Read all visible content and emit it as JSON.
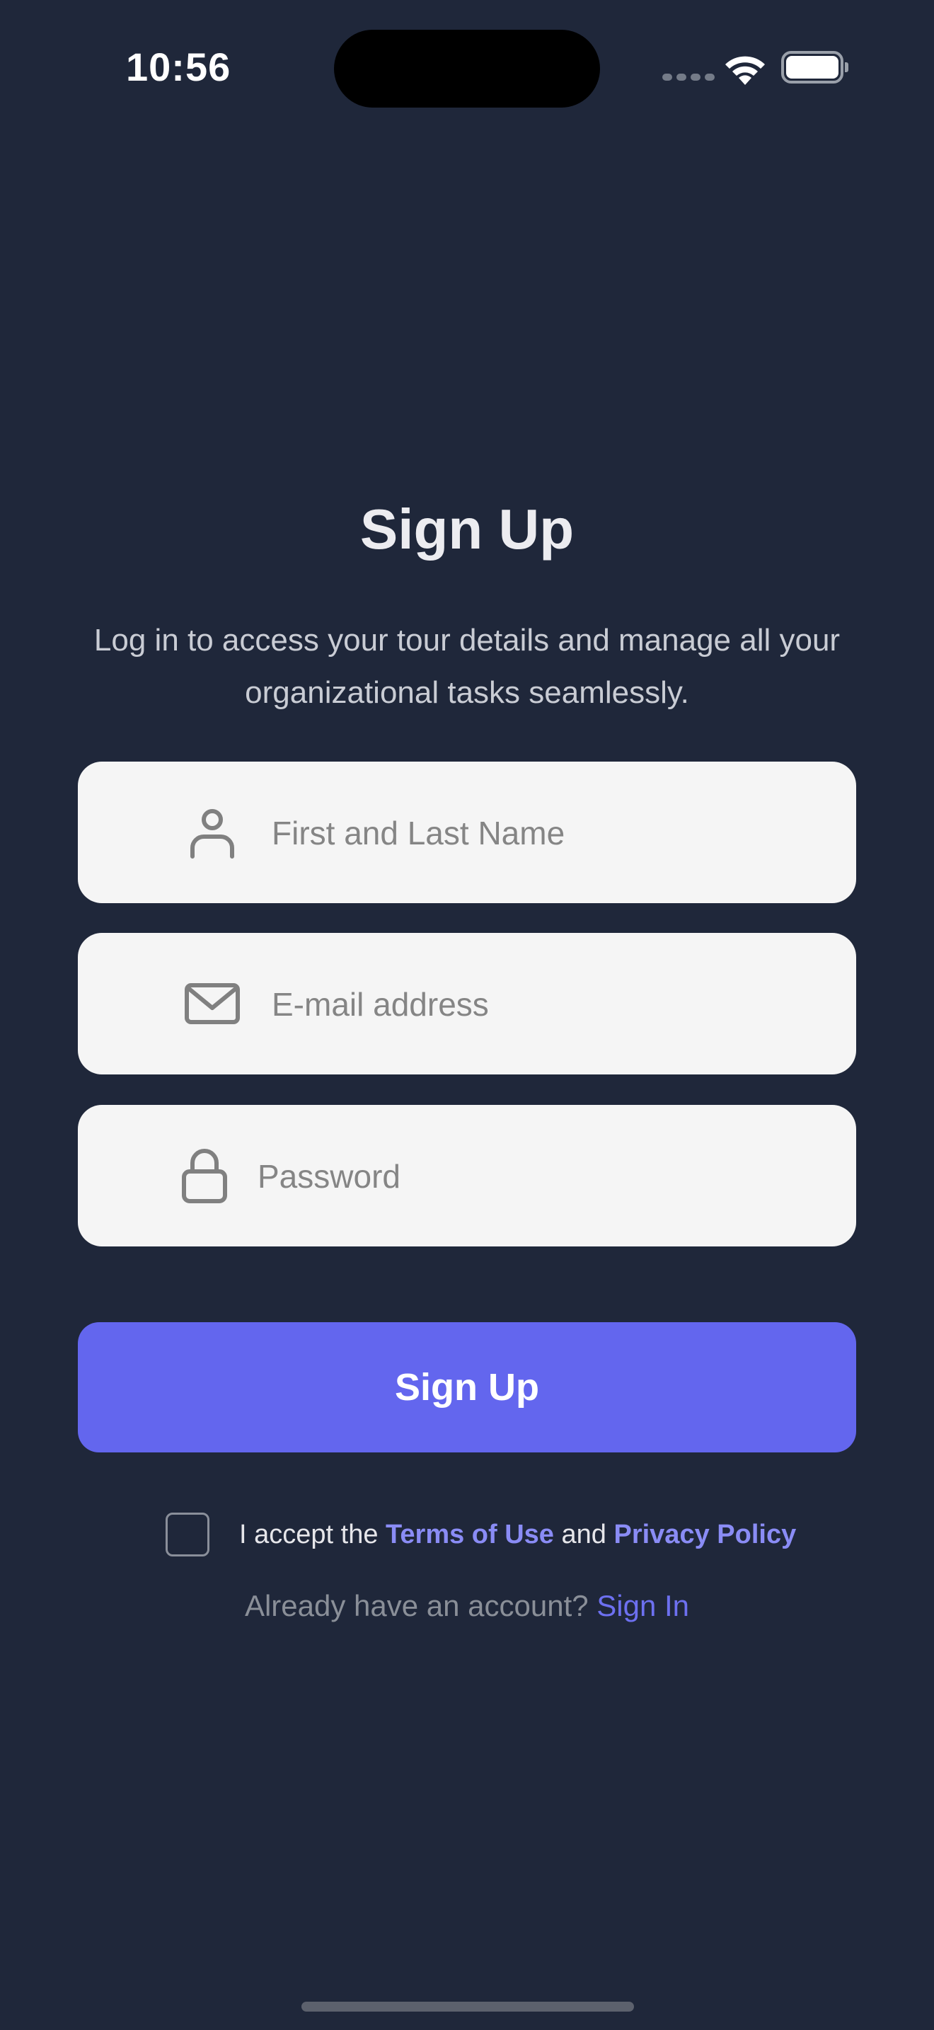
{
  "status_bar": {
    "time": "10:56"
  },
  "signup": {
    "title": "Sign Up",
    "subtitle_line1": "Log in to access your tour details and manage all your",
    "subtitle_line2": "organizational tasks seamlessly.",
    "fields": {
      "name": {
        "placeholder": "First and Last Name",
        "value": "",
        "icon": "person-icon"
      },
      "email": {
        "placeholder": "E-mail address",
        "value": "",
        "icon": "envelope-icon"
      },
      "password": {
        "placeholder": "Password",
        "value": "",
        "icon": "lock-icon"
      }
    },
    "submit_label": "Sign Up",
    "terms": {
      "checked": false,
      "prefix": "I accept the ",
      "terms_link": "Terms of Use",
      "middle": " and ",
      "privacy_link": "Privacy Policy"
    },
    "signin_prompt": "Already have an account? ",
    "signin_link": "Sign In"
  },
  "colors": {
    "background": "#1f273a",
    "primary": "#6366ee",
    "link": "#8a8cf5",
    "field_bg": "#f5f5f5"
  }
}
